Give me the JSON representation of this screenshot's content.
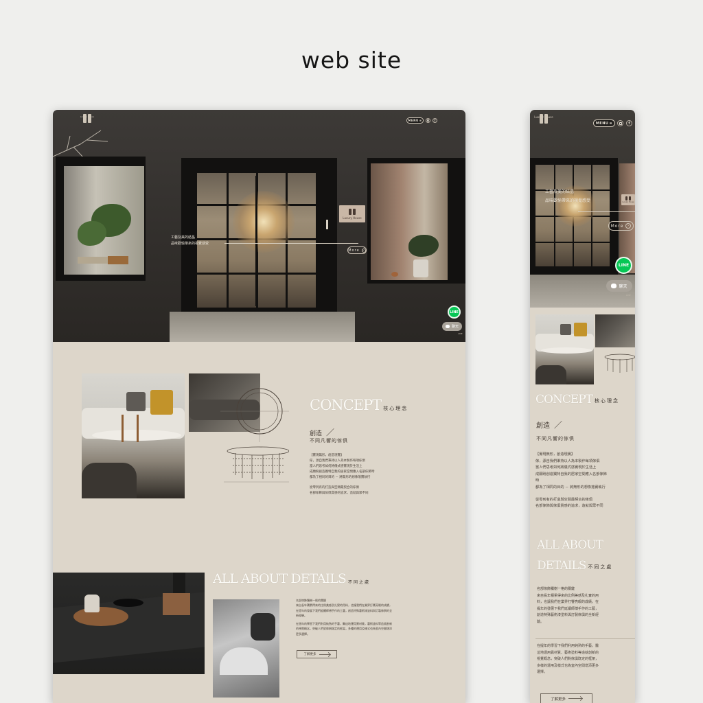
{
  "showcase": {
    "title": "web site"
  },
  "desktop": {
    "header": {
      "logo_text": "Luxury House",
      "menu_label": "MENU",
      "menu_icon": "hamburger-icon",
      "instagram_icon": "instagram-icon",
      "facebook_icon": "facebook-icon",
      "fb_glyph": "f"
    },
    "hero": {
      "sign_text": "Luxury House",
      "line1": "工藝及美的結晶",
      "line2": "品味歡愉帶來的視覺感受",
      "more_label": "More",
      "more_arrow": "›",
      "line_icon_label": "LINE",
      "chat_label": "聊天",
      "chat_subtext": "LINE"
    },
    "concept": {
      "heading_en": "CONCEPT",
      "heading_zh": "核心理念",
      "sub_title": "創造",
      "sub_slash": "／",
      "sub_caption": "不同凡響的傢俱",
      "body": [
        "【實現無形，創造現實】",
        "傢，源自我們秉持以人為本製作每項傢俱",
        "當人們思考如何將儀式感實現於生活上",
        "成願盼創造獨特自我的居家空間應入名部傢飾時",
        "都為了相同的目的 － 將無形的想像落實執行",
        "從零到有的打造與空間最契合的傢俱",
        "名部傢飾與傢俱質感的追求，造就與眾不同"
      ]
    },
    "details": {
      "heading_en": "ALL ABOUT DETAILS",
      "heading_zh": "不同之處",
      "body": [
        "名部傢飾獨樹一格的關鍵",
        "來自長年積累得來的比例美感及扎實的用料，也讓我們在業界打響亮眼的成績，",
        "在提年的發展下我們延續師傅手作的工藝，創造特殊藝術漆塗料與訂製傢俱的全",
        "新經驗。",
        "在過年的學習下我們利用純熟的手藝，醫這地運用異材質，藝術塗料等造就創新",
        "的視覺概念，突破人們對傢俱既定的框架，多種的運用及樣式也為室內空間增添",
        "更多選擇。"
      ],
      "learn_more": "了解更多"
    }
  },
  "mobile": {
    "header": {
      "logo_text": "Luxury House",
      "menu_label": "MENU",
      "menu_icon": "hamburger-icon",
      "instagram_icon": "instagram-icon",
      "facebook_icon": "facebook-icon",
      "fb_glyph": "f"
    },
    "hero": {
      "sign_text": "Luxury House",
      "line1": "工藝及美的結晶",
      "line2": "品味歡愉帶來的視覺感受",
      "more_label": "More",
      "more_arrow": "›",
      "line_icon_label": "LINE",
      "chat_label": "聊天",
      "chat_subtext": "LINE"
    },
    "concept": {
      "heading_en": "CONCEPT",
      "heading_zh": "核心理念",
      "sub_title": "創造",
      "sub_slash": "／",
      "sub_caption": "不同凡響的傢俱",
      "body": [
        "【實現無形，創造現實】",
        "傢，源自我們秉持以人為本製作每項傢俱",
        "當人們思考如何將儀式感實現於生活上",
        "成願盼創造獨特自我的居家空間應入名部傢飾",
        "時",
        "都為了相同的目的 － 將無形的想像落實執行",
        "從零到有的打造與空間最契合的傢俱",
        "名部傢飾與傢俱質感的追求，造就與眾不同"
      ]
    },
    "details": {
      "heading_line1": "ALL ABOUT",
      "heading_line2": "DETAILS",
      "heading_zh": "不同之處",
      "body": [
        "名部傢飾獨樹一格的關鍵",
        "來自長年積累得來的比例美感及扎實的用",
        "料，也讓我們在業界打響亮眼的成績，在",
        "提年的發展下我們延續師傅手作的工藝，",
        "創造特殊藝術漆塗料與訂製傢俱的全新經",
        "驗。",
        "在提年的學習下我們利用純熟的手藝，醫",
        "這地運用異材質、藝術塗料等造就創新的",
        "視覺概念，突破人們對傢俱既定的框架，",
        "多樣的運用及樣式也為室內空間增添更多",
        "選擇。"
      ],
      "learn_more": "了解更多"
    }
  },
  "colors": {
    "page_bg": "#efefed",
    "site_bg": "#ddd6ca",
    "hero_dark": "#34312d",
    "line_green": "#06c755",
    "text": "#4a4139"
  }
}
